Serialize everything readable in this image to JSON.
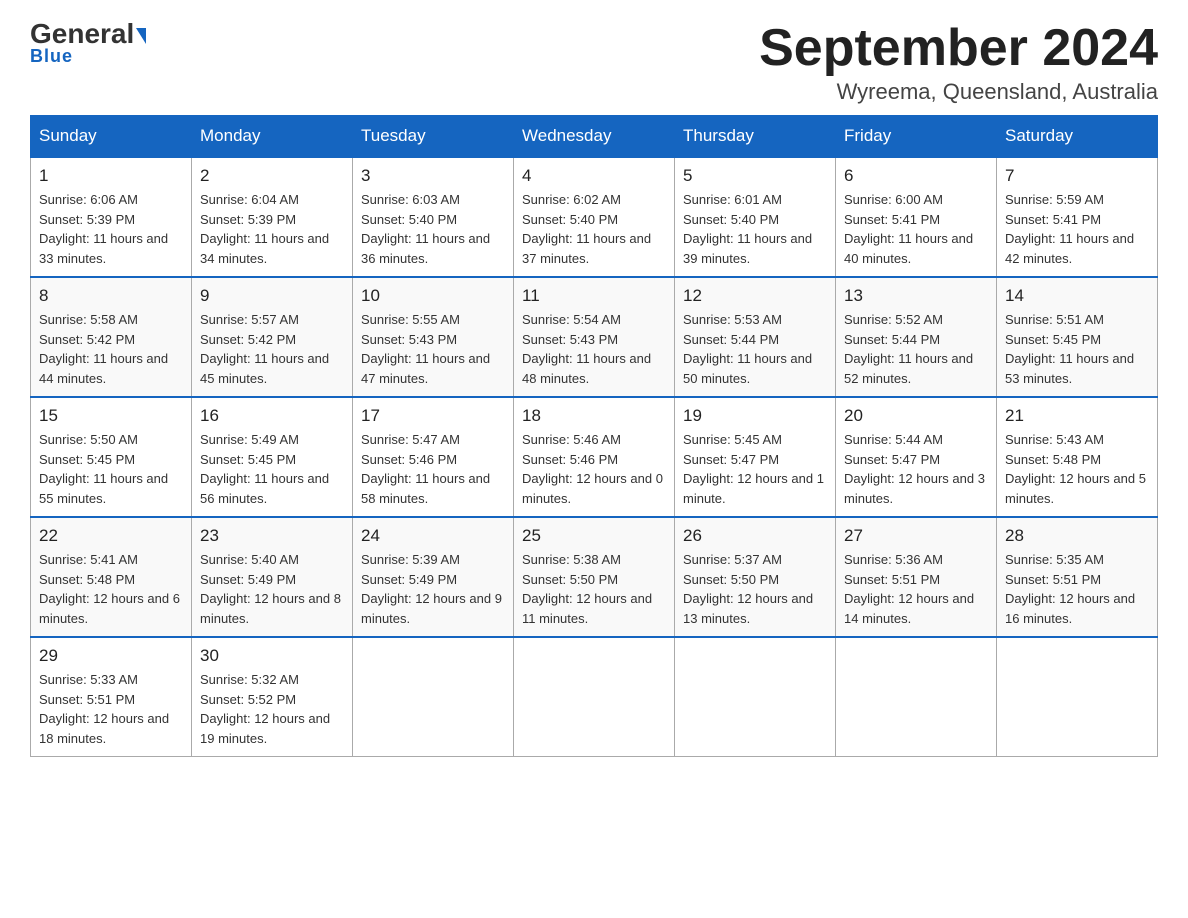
{
  "header": {
    "logo_general": "General",
    "logo_blue": "Blue",
    "title": "September 2024",
    "location": "Wyreema, Queensland, Australia"
  },
  "weekdays": [
    "Sunday",
    "Monday",
    "Tuesday",
    "Wednesday",
    "Thursday",
    "Friday",
    "Saturday"
  ],
  "weeks": [
    [
      {
        "day": "1",
        "sunrise": "6:06 AM",
        "sunset": "5:39 PM",
        "daylight": "11 hours and 33 minutes."
      },
      {
        "day": "2",
        "sunrise": "6:04 AM",
        "sunset": "5:39 PM",
        "daylight": "11 hours and 34 minutes."
      },
      {
        "day": "3",
        "sunrise": "6:03 AM",
        "sunset": "5:40 PM",
        "daylight": "11 hours and 36 minutes."
      },
      {
        "day": "4",
        "sunrise": "6:02 AM",
        "sunset": "5:40 PM",
        "daylight": "11 hours and 37 minutes."
      },
      {
        "day": "5",
        "sunrise": "6:01 AM",
        "sunset": "5:40 PM",
        "daylight": "11 hours and 39 minutes."
      },
      {
        "day": "6",
        "sunrise": "6:00 AM",
        "sunset": "5:41 PM",
        "daylight": "11 hours and 40 minutes."
      },
      {
        "day": "7",
        "sunrise": "5:59 AM",
        "sunset": "5:41 PM",
        "daylight": "11 hours and 42 minutes."
      }
    ],
    [
      {
        "day": "8",
        "sunrise": "5:58 AM",
        "sunset": "5:42 PM",
        "daylight": "11 hours and 44 minutes."
      },
      {
        "day": "9",
        "sunrise": "5:57 AM",
        "sunset": "5:42 PM",
        "daylight": "11 hours and 45 minutes."
      },
      {
        "day": "10",
        "sunrise": "5:55 AM",
        "sunset": "5:43 PM",
        "daylight": "11 hours and 47 minutes."
      },
      {
        "day": "11",
        "sunrise": "5:54 AM",
        "sunset": "5:43 PM",
        "daylight": "11 hours and 48 minutes."
      },
      {
        "day": "12",
        "sunrise": "5:53 AM",
        "sunset": "5:44 PM",
        "daylight": "11 hours and 50 minutes."
      },
      {
        "day": "13",
        "sunrise": "5:52 AM",
        "sunset": "5:44 PM",
        "daylight": "11 hours and 52 minutes."
      },
      {
        "day": "14",
        "sunrise": "5:51 AM",
        "sunset": "5:45 PM",
        "daylight": "11 hours and 53 minutes."
      }
    ],
    [
      {
        "day": "15",
        "sunrise": "5:50 AM",
        "sunset": "5:45 PM",
        "daylight": "11 hours and 55 minutes."
      },
      {
        "day": "16",
        "sunrise": "5:49 AM",
        "sunset": "5:45 PM",
        "daylight": "11 hours and 56 minutes."
      },
      {
        "day": "17",
        "sunrise": "5:47 AM",
        "sunset": "5:46 PM",
        "daylight": "11 hours and 58 minutes."
      },
      {
        "day": "18",
        "sunrise": "5:46 AM",
        "sunset": "5:46 PM",
        "daylight": "12 hours and 0 minutes."
      },
      {
        "day": "19",
        "sunrise": "5:45 AM",
        "sunset": "5:47 PM",
        "daylight": "12 hours and 1 minute."
      },
      {
        "day": "20",
        "sunrise": "5:44 AM",
        "sunset": "5:47 PM",
        "daylight": "12 hours and 3 minutes."
      },
      {
        "day": "21",
        "sunrise": "5:43 AM",
        "sunset": "5:48 PM",
        "daylight": "12 hours and 5 minutes."
      }
    ],
    [
      {
        "day": "22",
        "sunrise": "5:41 AM",
        "sunset": "5:48 PM",
        "daylight": "12 hours and 6 minutes."
      },
      {
        "day": "23",
        "sunrise": "5:40 AM",
        "sunset": "5:49 PM",
        "daylight": "12 hours and 8 minutes."
      },
      {
        "day": "24",
        "sunrise": "5:39 AM",
        "sunset": "5:49 PM",
        "daylight": "12 hours and 9 minutes."
      },
      {
        "day": "25",
        "sunrise": "5:38 AM",
        "sunset": "5:50 PM",
        "daylight": "12 hours and 11 minutes."
      },
      {
        "day": "26",
        "sunrise": "5:37 AM",
        "sunset": "5:50 PM",
        "daylight": "12 hours and 13 minutes."
      },
      {
        "day": "27",
        "sunrise": "5:36 AM",
        "sunset": "5:51 PM",
        "daylight": "12 hours and 14 minutes."
      },
      {
        "day": "28",
        "sunrise": "5:35 AM",
        "sunset": "5:51 PM",
        "daylight": "12 hours and 16 minutes."
      }
    ],
    [
      {
        "day": "29",
        "sunrise": "5:33 AM",
        "sunset": "5:51 PM",
        "daylight": "12 hours and 18 minutes."
      },
      {
        "day": "30",
        "sunrise": "5:32 AM",
        "sunset": "5:52 PM",
        "daylight": "12 hours and 19 minutes."
      },
      null,
      null,
      null,
      null,
      null
    ]
  ]
}
